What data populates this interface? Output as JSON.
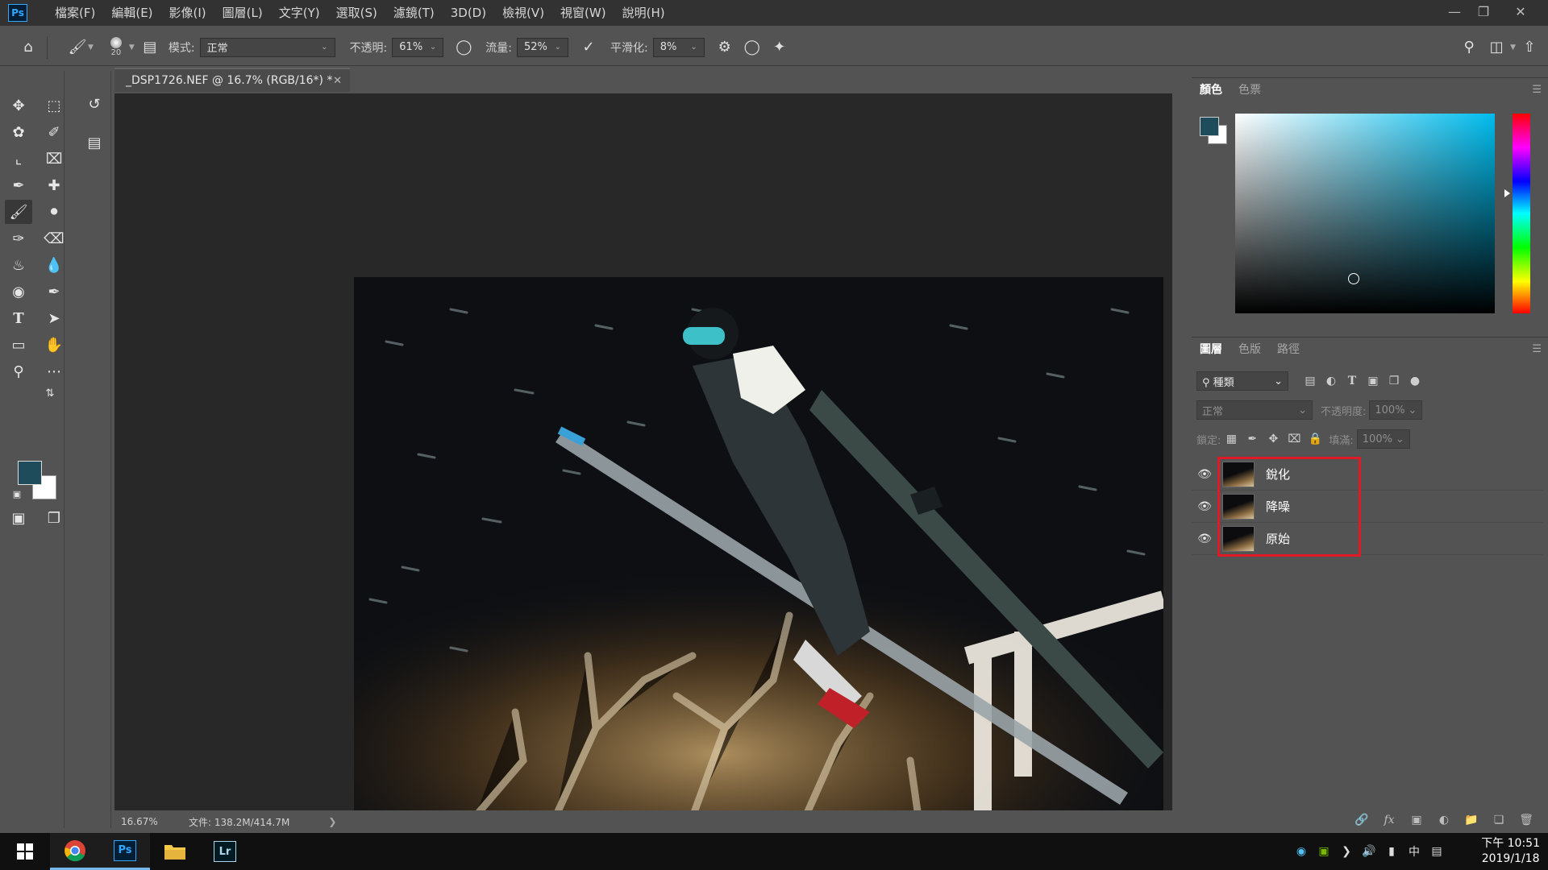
{
  "app": {
    "logo": "Ps",
    "menu": [
      "檔案(F)",
      "編輯(E)",
      "影像(I)",
      "圖層(L)",
      "文字(Y)",
      "選取(S)",
      "濾鏡(T)",
      "3D(D)",
      "檢視(V)",
      "視窗(W)",
      "說明(H)"
    ]
  },
  "options": {
    "brush_size": "20",
    "mode_label": "模式:",
    "mode_value": "正常",
    "opacity_label": "不透明:",
    "opacity_value": "61%",
    "flow_label": "流量:",
    "flow_value": "52%",
    "smoothing_label": "平滑化:",
    "smoothing_value": "8%"
  },
  "document": {
    "tab_title": "_DSP1726.NEF @ 16.7% (RGB/16*) *",
    "zoom": "16.67%",
    "file_info": "文件: 138.2M/414.7M"
  },
  "color_panel": {
    "tabs": [
      "顏色",
      "色票"
    ],
    "foreground": "#1e4c5a",
    "background": "#ffffff",
    "field_hue": "#00bcee"
  },
  "layers_panel": {
    "tabs": [
      "圖層",
      "色版",
      "路徑"
    ],
    "filter_kind": "種類",
    "blend_mode": "正常",
    "opacity_label": "不透明度:",
    "opacity_value": "100%",
    "lock_label": "鎖定:",
    "fill_label": "填滿:",
    "fill_value": "100%",
    "layers": [
      {
        "name": "銳化",
        "visible": true
      },
      {
        "name": "降噪",
        "visible": true
      },
      {
        "name": "原始",
        "visible": true
      }
    ],
    "highlight_color": "#e01926"
  },
  "taskbar": {
    "apps": [
      "windows-start",
      "chrome",
      "photoshop",
      "file-explorer",
      "lightroom"
    ],
    "ps_label": "Ps",
    "lr_label": "Lr",
    "ime": "中",
    "time": "下午 10:51",
    "date": "2019/1/18"
  }
}
